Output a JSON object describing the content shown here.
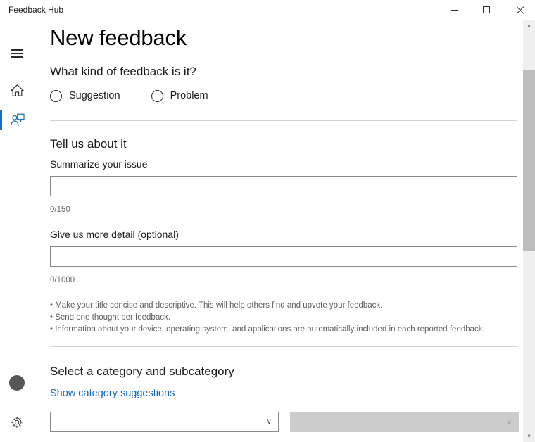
{
  "window": {
    "title": "Feedback Hub",
    "minimize_label": "−",
    "maximize_label": "□",
    "close_label": "✕"
  },
  "sidebar": {
    "menu_icon": "hamburger-icon",
    "items": [
      {
        "icon": "home-icon",
        "label": "Home",
        "selected": false
      },
      {
        "icon": "feedback-icon",
        "label": "Feedback",
        "selected": true
      }
    ],
    "account_icon": "avatar-icon",
    "settings_icon": "gear-icon",
    "accent_color": "#1b6ec2"
  },
  "scrollbar": {
    "up_arrow": "∧",
    "down_arrow": "∨"
  },
  "main": {
    "page_title": "New feedback",
    "kind_section": {
      "heading": "What kind of feedback is it?",
      "options": [
        {
          "label": "Suggestion",
          "selected": false
        },
        {
          "label": "Problem",
          "selected": false
        }
      ]
    },
    "details_section": {
      "heading": "Tell us about it",
      "summary_label": "Summarize your issue",
      "summary_value": "",
      "summary_placeholder": "",
      "summary_counter": "0/150",
      "detail_label": "Give us more detail (optional)",
      "detail_value": "",
      "detail_placeholder": "",
      "detail_counter": "0/1000",
      "tips": [
        "• Make your title concise and descriptive. This will help others find and upvote your feedback.",
        "• Send one thought per feedback.",
        "• Information about your device, operating system, and applications are automatically included in each reported feedback."
      ]
    },
    "category_section": {
      "heading": "Select a category and subcategory",
      "suggestions_link": "Show category suggestions",
      "category_value": "",
      "category_arrow": "∨",
      "subcategory_value": "",
      "subcategory_arrow": "∨",
      "subcategory_disabled": true
    }
  }
}
